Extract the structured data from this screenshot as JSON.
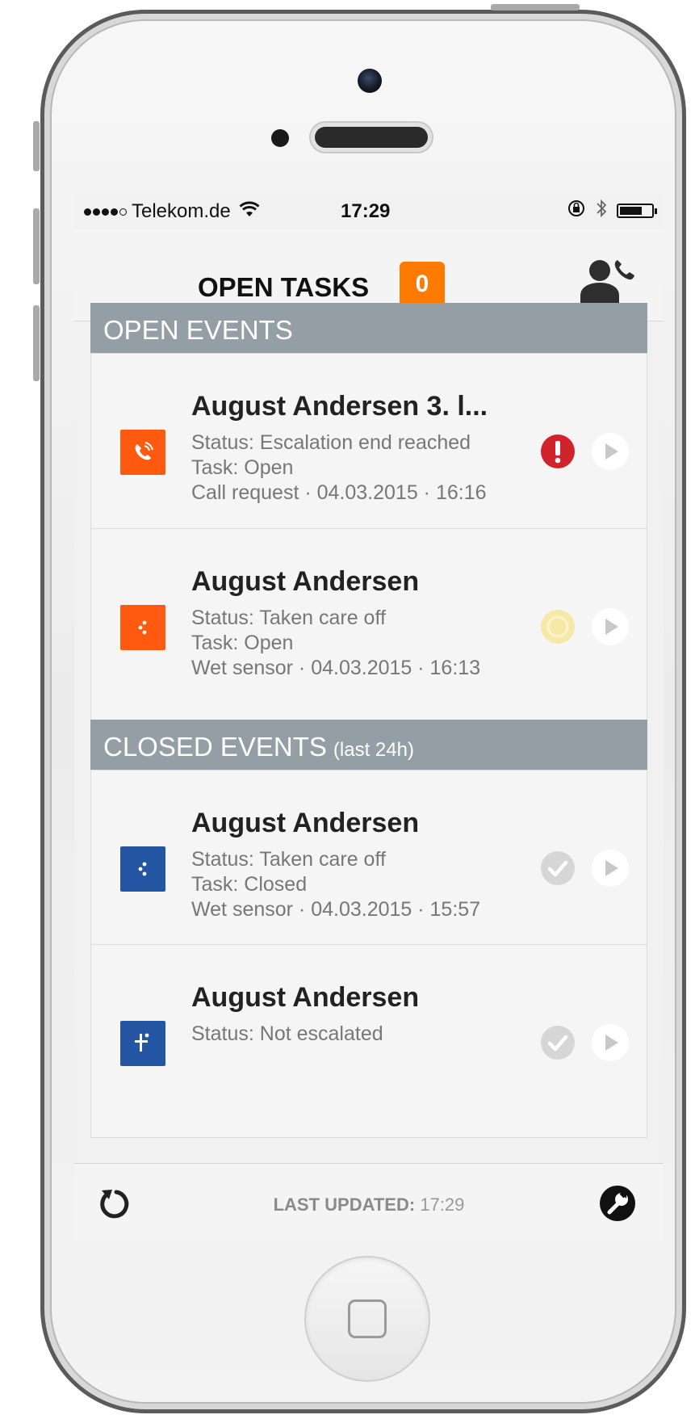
{
  "statusbar": {
    "carrier": "Telekom.de",
    "time": "17:29",
    "battery_level": 0.7
  },
  "header": {
    "title": "OPEN TASKS",
    "badge_count": "0"
  },
  "sections": {
    "open": {
      "title": "OPEN EVENTS",
      "subtitle": ""
    },
    "closed": {
      "title": "CLOSED EVENTS",
      "subtitle": "(last 24h)"
    }
  },
  "events": [
    {
      "name": "August Andersen 3. l...",
      "status": "Status: Escalation end reached",
      "task": "Task: Open",
      "meta": "Call request · 04.03.2015 · 16:16",
      "icon": "phone-icon",
      "icon_color": "#ff5a10",
      "state_icon": "alert-icon",
      "state_color": "#d0232b"
    },
    {
      "name": "August Andersen",
      "status": "Status: Taken care off",
      "task": "Task: Open",
      "meta": "Wet sensor · 04.03.2015 · 16:13",
      "icon": "wet-sensor-icon",
      "icon_color": "#ff5a10",
      "state_icon": "pending-icon",
      "state_color": "#f4e49a"
    },
    {
      "name": "August Andersen",
      "status": "Status: Taken care off",
      "task": "Task: Closed",
      "meta": "Wet sensor · 04.03.2015 · 15:57",
      "icon": "wet-sensor-icon",
      "icon_color": "#2456a4",
      "state_icon": "check-icon",
      "state_color": "#d4d4d4"
    },
    {
      "name": "August Andersen",
      "status": "Status: Not escalated",
      "task": "",
      "meta": "",
      "icon": "sensor-icon",
      "icon_color": "#2456a4",
      "state_icon": "check-icon",
      "state_color": "#d4d4d4"
    }
  ],
  "footer": {
    "updated_label": "LAST UPDATED:",
    "updated_time": "17:29"
  }
}
